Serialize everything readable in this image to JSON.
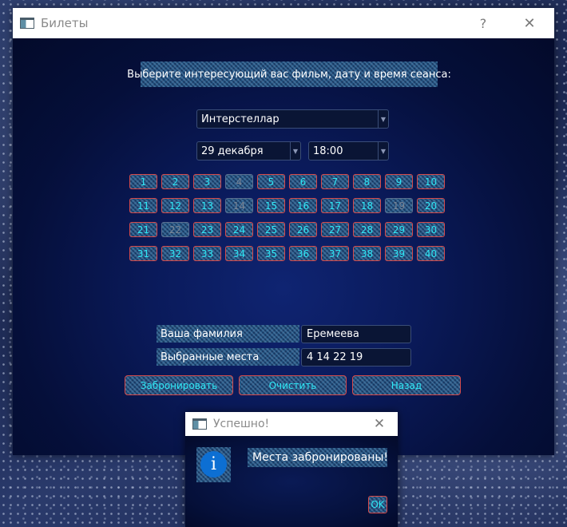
{
  "window": {
    "title": "Билеты",
    "help_glyph": "?",
    "close_glyph": "✕"
  },
  "instruction": "Выберите интересующий вас фильм, дату и время сеанса:",
  "movie_select": {
    "value": "Интерстеллар"
  },
  "date_select": {
    "value": "29 декабря"
  },
  "time_select": {
    "value": "18:00"
  },
  "seats": {
    "labels": [
      "1",
      "2",
      "3",
      "4",
      "5",
      "6",
      "7",
      "8",
      "9",
      "10",
      "11",
      "12",
      "13",
      "14",
      "15",
      "16",
      "17",
      "18",
      "19",
      "20",
      "21",
      "22",
      "23",
      "24",
      "25",
      "26",
      "27",
      "28",
      "29",
      "30",
      "31",
      "32",
      "33",
      "34",
      "35",
      "36",
      "37",
      "38",
      "39",
      "40"
    ],
    "disabled": [
      "4",
      "14",
      "19",
      "22"
    ]
  },
  "form": {
    "surname_label": "Ваша фамилия",
    "surname_value": "Еремеева",
    "seats_label": "Выбранные места",
    "seats_value": "4 14 22 19"
  },
  "buttons": {
    "book": "Забронировать",
    "clear": "Очистить",
    "back": "Назад"
  },
  "dialog": {
    "title": "Успешно!",
    "close_glyph": "✕",
    "icon_glyph": "i",
    "message": "Места забронированы!",
    "ok": "OK"
  },
  "colors": {
    "accent_text": "#2ee8f6",
    "button_border": "#d64a4a"
  }
}
